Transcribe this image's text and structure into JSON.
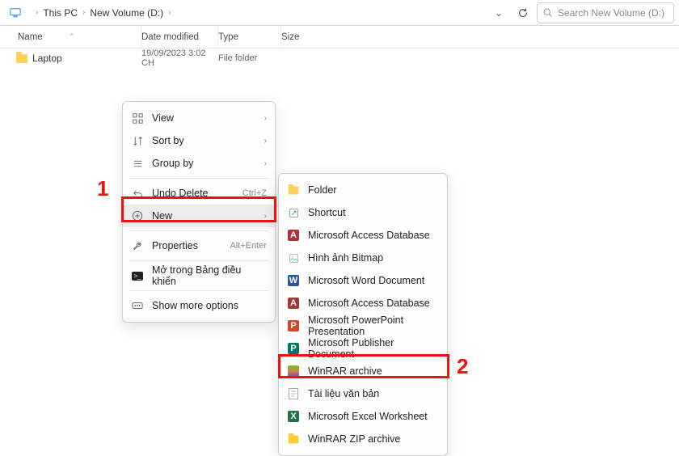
{
  "breadcrumb": {
    "seg1": "This PC",
    "seg2": "New Volume (D:)"
  },
  "search": {
    "placeholder": "Search New Volume (D:)"
  },
  "columns": {
    "name": "Name",
    "date": "Date modified",
    "type": "Type",
    "size": "Size"
  },
  "rows": [
    {
      "name": "Laptop",
      "date": "19/09/2023 3:02 CH",
      "type": "File folder",
      "size": ""
    }
  ],
  "context_menu": {
    "view": "View",
    "sort_by": "Sort by",
    "group_by": "Group by",
    "undo_delete": "Undo Delete",
    "undo_shortcut": "Ctrl+Z",
    "new": "New",
    "properties": "Properties",
    "properties_shortcut": "Alt+Enter",
    "open_panel": "Mở trong Bảng điều khiển",
    "show_more": "Show more options"
  },
  "new_submenu": {
    "items": [
      {
        "icon": "folder",
        "label": "Folder"
      },
      {
        "icon": "shortcut",
        "label": "Shortcut"
      },
      {
        "icon": "access",
        "label": "Microsoft Access Database"
      },
      {
        "icon": "bitmap",
        "label": "Hình ảnh Bitmap"
      },
      {
        "icon": "word",
        "label": "Microsoft Word Document"
      },
      {
        "icon": "access",
        "label": "Microsoft Access Database"
      },
      {
        "icon": "ppt",
        "label": "Microsoft PowerPoint Presentation"
      },
      {
        "icon": "pub",
        "label": "Microsoft Publisher Document"
      },
      {
        "icon": "rar",
        "label": "WinRAR archive"
      },
      {
        "icon": "txt",
        "label": "Tài liệu văn bản"
      },
      {
        "icon": "xls",
        "label": "Microsoft Excel Worksheet"
      },
      {
        "icon": "zip",
        "label": "WinRAR ZIP archive"
      }
    ]
  },
  "annotations": {
    "n1": "1",
    "n2": "2"
  }
}
